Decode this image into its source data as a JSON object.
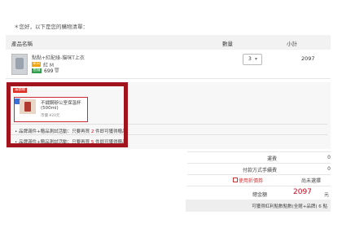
{
  "greeting": "＊您好，以下是您的購物清單：",
  "table": {
    "col_product": "產品名稱",
    "col_qty": "數量",
    "col_subtotal": "小計"
  },
  "item": {
    "name": "點點+紅配綠-貓咪T上衣",
    "tag_color": "米白",
    "size": "紅 M",
    "tag_price": "售價",
    "price": "699",
    "qty": "3",
    "qty_arrow": "▾",
    "subtotal": "2097"
  },
  "gift": {
    "label": "滿額贈",
    "name_line1": "不鏽鋼辦公室保溫杯",
    "name_line2": "(500ml)",
    "price": "市價 ¥20元",
    "promo1_prefix": "品牌滿件+贈品測試活動：只要再買",
    "promo1_count": "2",
    "promo1_suffix": "件即可獲得贈品",
    "promo2_prefix": "品牌滿件+贈品測試活動：只要再買",
    "promo2_count": "5",
    "promo2_suffix": "件即可獲得贈品"
  },
  "summary": {
    "shipping_label": "運費",
    "shipping_value": "0",
    "payment_fee_label": "付款方式手續費",
    "payment_fee_value": "0",
    "coupon_label": "使用折價券",
    "coupon_value": "尚未選擇",
    "total_label": "總金額",
    "total_value": "2097",
    "total_unit": "元",
    "points_text": "可獲得紅利點數點數(全館+品牌) 6 點"
  },
  "colors": {
    "accent_red": "#d0021b",
    "highlight_border": "#a1131d"
  }
}
